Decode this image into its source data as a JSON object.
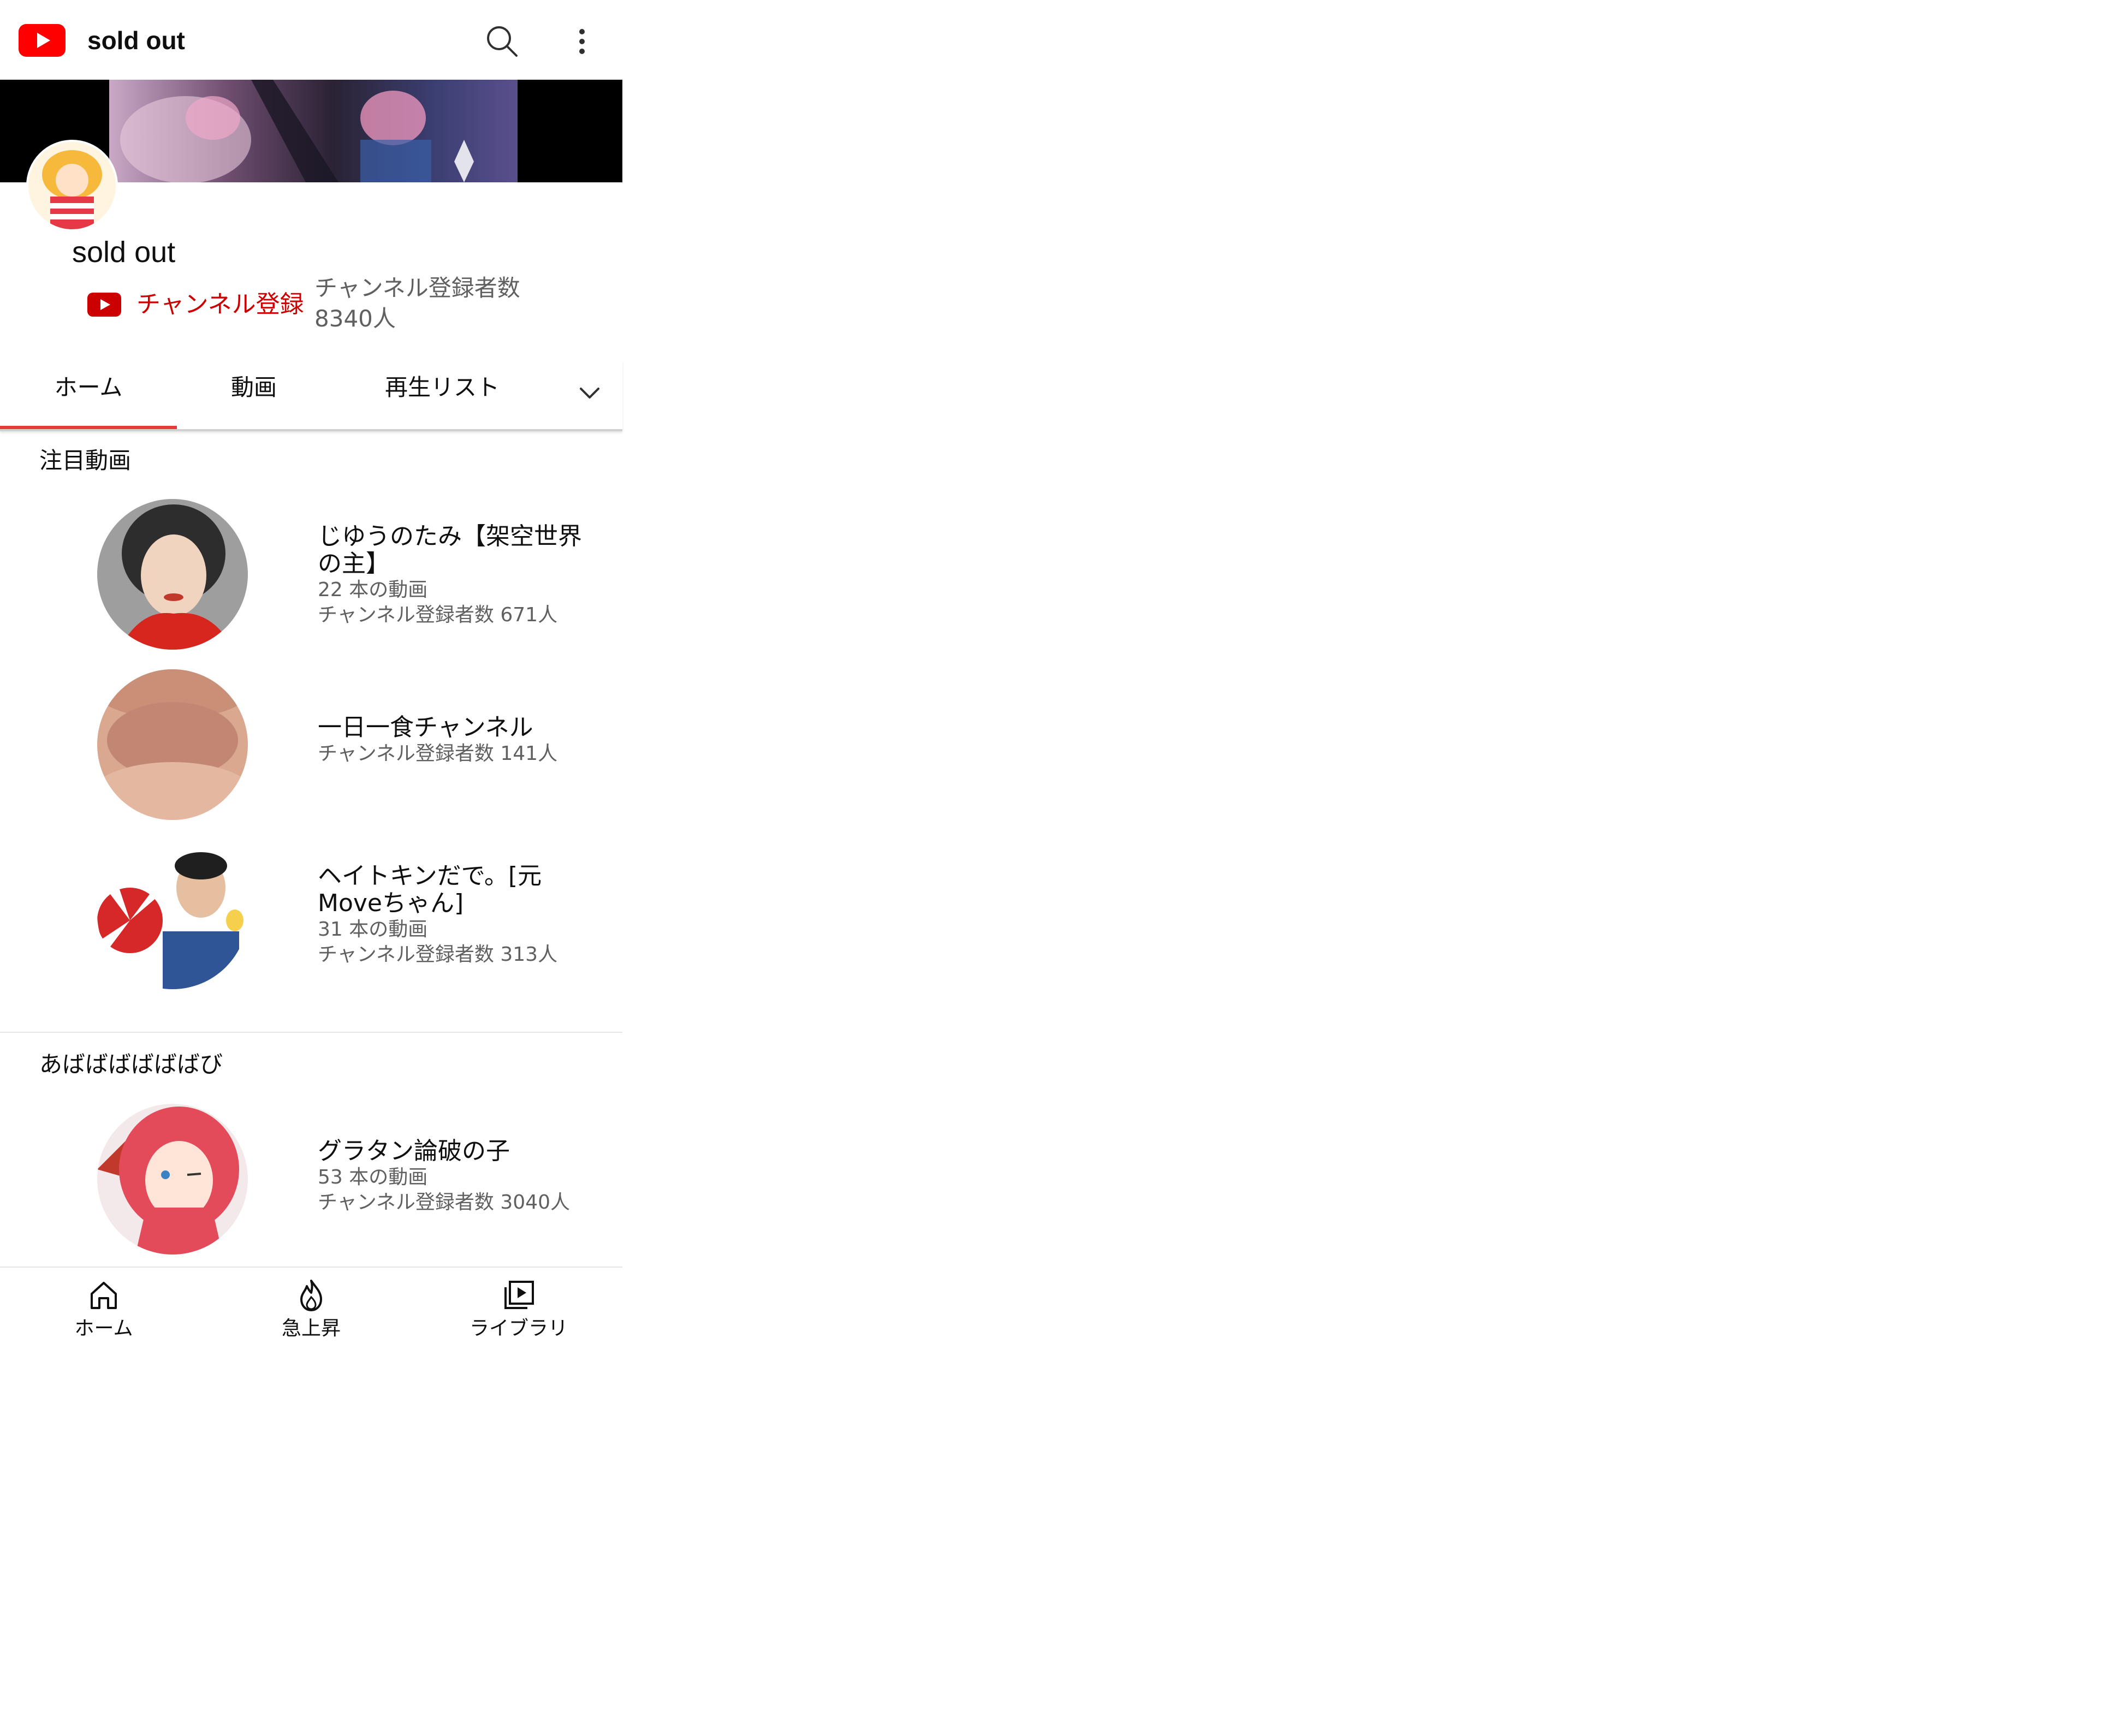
{
  "header": {
    "title": "sold out",
    "logo_icon": "youtube-logo-icon",
    "search_icon": "search-icon",
    "more_icon": "more-vert-icon",
    "brand_color": "#ff0000"
  },
  "channel": {
    "name": "sold out",
    "subscribe_label": "チャンネル登録",
    "subscriber_count": "チャンネル登録者数 8340人",
    "subscribe_color": "#cc0000"
  },
  "tabs": {
    "items": [
      {
        "label": "ホーム",
        "active": true
      },
      {
        "label": "動画",
        "active": false
      },
      {
        "label": "再生リスト",
        "active": false
      }
    ],
    "more_icon": "chevron-down-icon",
    "active_color": "#e53935"
  },
  "sections": [
    {
      "title": "注目動画",
      "channels": [
        {
          "name": "じゆうのたみ【架空世界の主】",
          "videos": "22 本の動画",
          "subscribers": "チャンネル登録者数 671人"
        },
        {
          "name": "一日一食チャンネル",
          "videos": "",
          "subscribers": "チャンネル登録者数 141人"
        },
        {
          "name": "ヘイトキンだで。[元Moveちゃん]",
          "videos": "31 本の動画",
          "subscribers": "チャンネル登録者数 313人"
        }
      ]
    },
    {
      "title": "あばばばばばばび",
      "channels": [
        {
          "name": "グラタン論破の子",
          "videos": "53 本の動画",
          "subscribers": "チャンネル登録者数 3040人"
        }
      ]
    }
  ],
  "bottom_nav": [
    {
      "label": "ホーム",
      "icon": "home-icon"
    },
    {
      "label": "急上昇",
      "icon": "trending-flame-icon"
    },
    {
      "label": "ライブラリ",
      "icon": "library-icon"
    }
  ]
}
